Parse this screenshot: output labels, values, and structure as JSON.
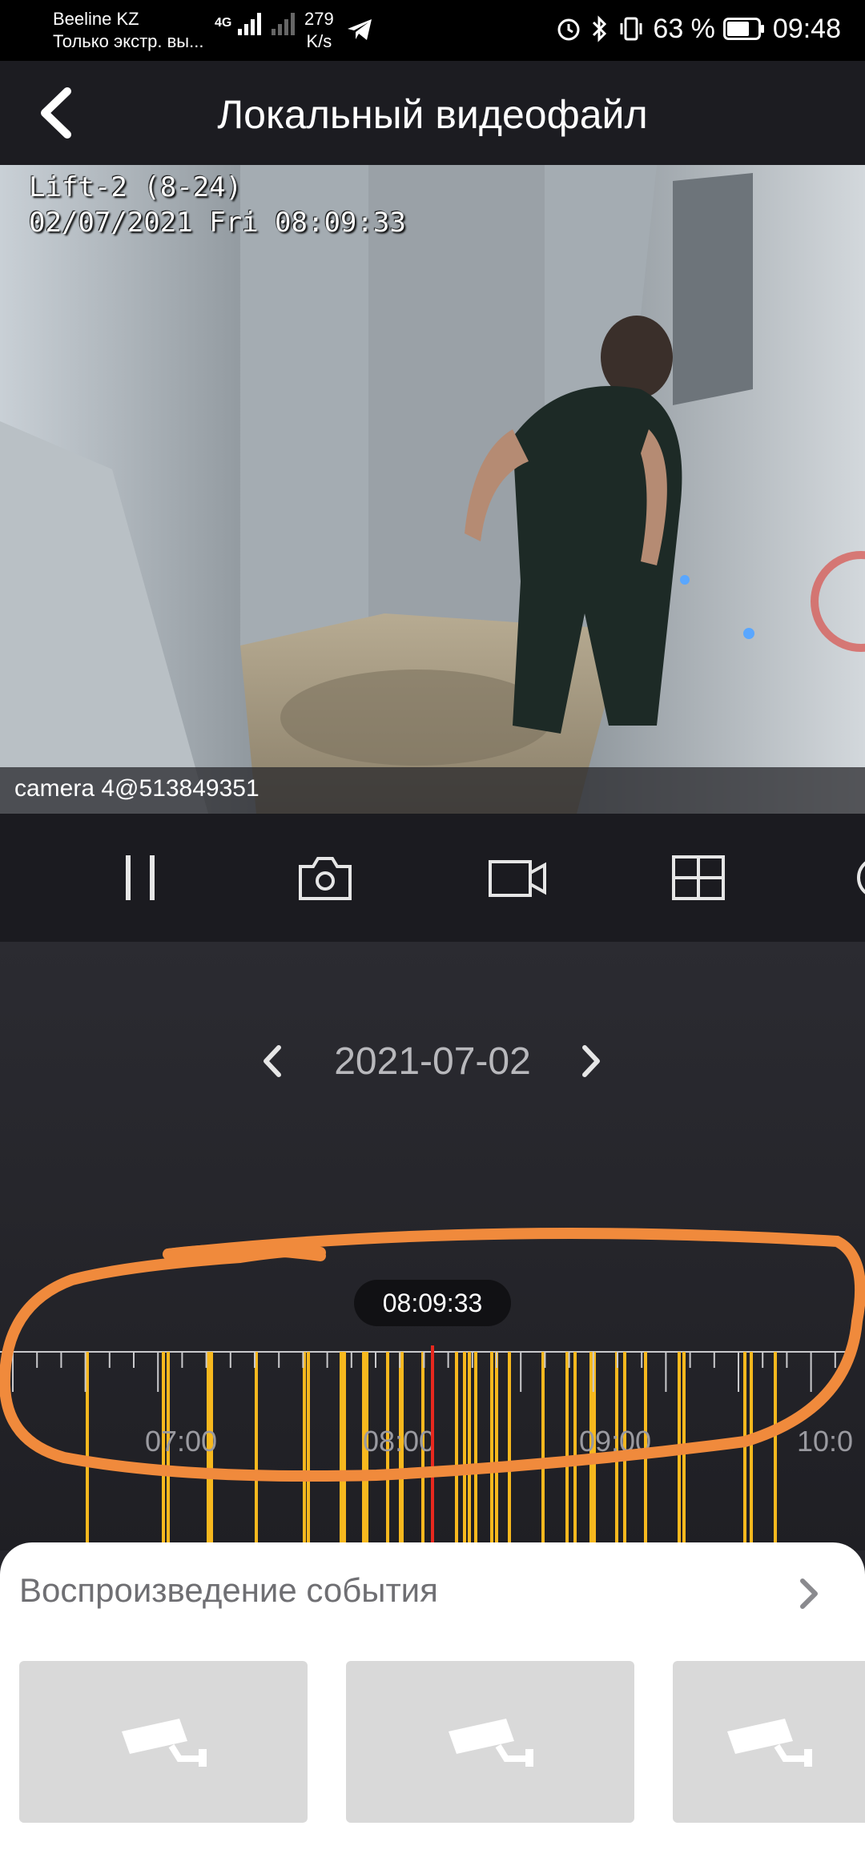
{
  "status_bar": {
    "carrier": "Beeline KZ",
    "carrier_sub": "Только экстр. вы...",
    "net_type": "4G",
    "net_speed_value": "279",
    "net_speed_unit": "K/s",
    "battery": "63 %",
    "time": "09:48"
  },
  "header": {
    "title": "Локальный видеофайл"
  },
  "video": {
    "osd_line1": "Lift-2 (8-24)",
    "osd_line2": "02/07/2021 Fri 08:09:33",
    "caption": "camera 4@513849351"
  },
  "controls": [
    {
      "name": "pause-button",
      "icon": "pause-icon"
    },
    {
      "name": "snapshot-button",
      "icon": "camera-icon"
    },
    {
      "name": "record-button",
      "icon": "video-camera-icon"
    },
    {
      "name": "layout-button",
      "icon": "grid-icon"
    }
  ],
  "playback": {
    "date": "2021-07-02",
    "current_time": "08:09:33",
    "hour_labels": [
      "07:00",
      "08:00",
      "09:00",
      "10:0"
    ]
  },
  "events": {
    "title": "Воспроизведение события"
  },
  "colors": {
    "record_mark": "#f7b81e",
    "playhead": "#e8281e",
    "annotation": "#f08a3c"
  }
}
